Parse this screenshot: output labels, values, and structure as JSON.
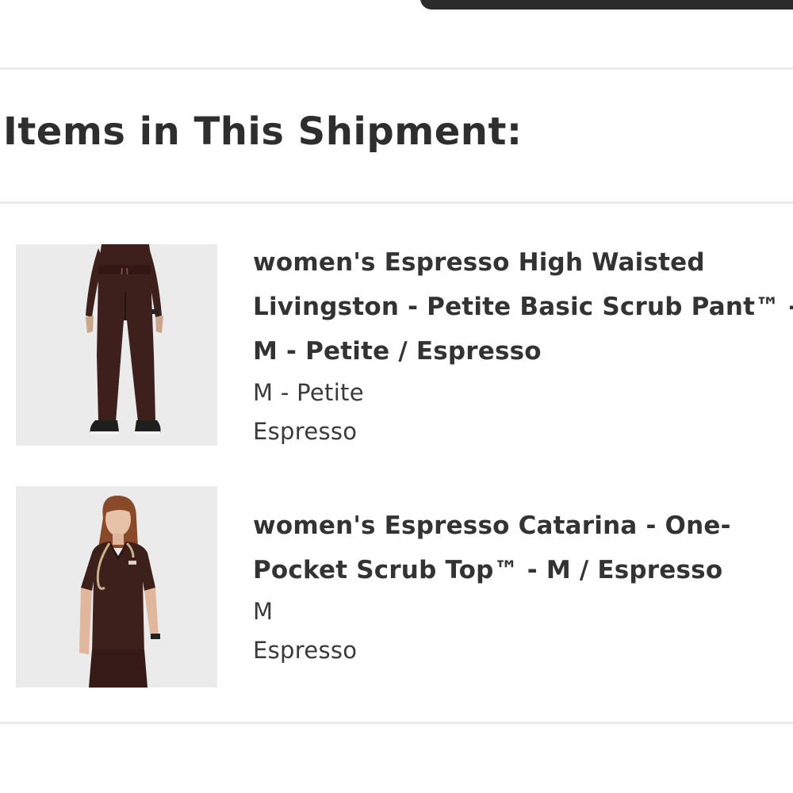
{
  "shipment": {
    "title": "Items in This Shipment:",
    "items": [
      {
        "name": "women's Espresso High Waisted Livingston - Petite Basic Scrub Pant™ - M - Petite / Espresso",
        "size": "M - Petite",
        "color": "Espresso",
        "thumbnail_icon": "scrub-pant-photo"
      },
      {
        "name": "women's Espresso Catarina - One-Pocket Scrub Top™ - M / Espresso",
        "size": "M",
        "color": "Espresso",
        "thumbnail_icon": "scrub-top-photo"
      }
    ]
  },
  "colors": {
    "product_espresso": "#3d1f1c",
    "text": "#333333",
    "divider": "#e9e9e9",
    "thumbnail_bg": "#ebebeb"
  }
}
